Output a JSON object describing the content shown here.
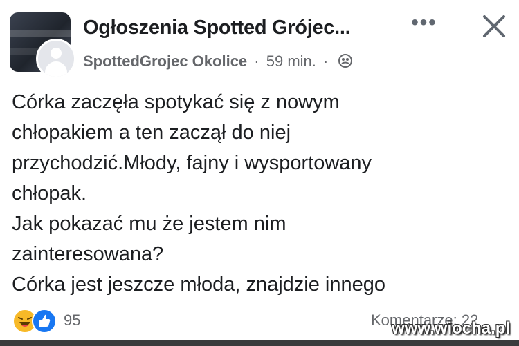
{
  "header": {
    "group_name": "Ogłoszenia Spotted Grójec...",
    "author": "SpottedGrojec Okolice",
    "separator": "·",
    "time": "59 min.",
    "more_label": "•••",
    "group_avatar_icon": "group-photo-icon",
    "user_avatar_icon": "default-avatar-icon",
    "privacy_icon": "group-privacy-icon",
    "close_icon": "close-icon"
  },
  "post": {
    "lines": [
      "Córka zaczęła spotykać się z nowym",
      "chłopakiem a ten zaczął do niej",
      "przychodzić.Młody, fajny i wysportowany",
      "chłopak.",
      "Jak pokazać mu że jestem nim",
      "zainteresowana?",
      "Córka jest jeszcze młoda, znajdzie innego"
    ]
  },
  "footer": {
    "reaction_count": "95",
    "comments_label": "Komentarze: 22",
    "reaction_icons": [
      "haha-icon",
      "like-icon"
    ]
  },
  "watermark": "www.wiocha.pl",
  "colors": {
    "text": "#1c1e21",
    "secondary": "#65676b",
    "like": "#1877f2",
    "haha": "#f7b928"
  }
}
